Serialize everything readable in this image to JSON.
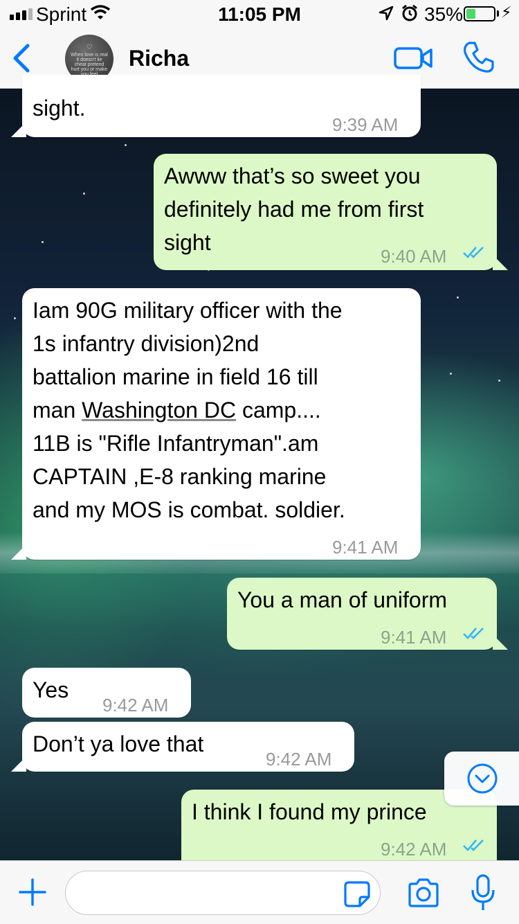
{
  "status_bar": {
    "carrier": "Sprint",
    "time": "11:05 PM",
    "battery_percent": "35%",
    "battery_level": 0.35,
    "icons": [
      "signal-bars-icon",
      "wifi-icon",
      "location-arrow-icon",
      "alarm-icon",
      "battery-icon",
      "charging-bolt-icon"
    ]
  },
  "header": {
    "contact_name": "Richa",
    "avatar_text": "When love is real it doesn't lie cheat pretend hurt you or make you feel unwanted",
    "icons": [
      "back-chevron-icon",
      "video-call-icon",
      "phone-call-icon"
    ]
  },
  "messages": [
    {
      "direction": "in",
      "text": "sight.",
      "time": "9:39 AM"
    },
    {
      "direction": "out",
      "lines": [
        "Awww that’s so sweet you",
        "definitely had me from first",
        "sight"
      ],
      "time": "9:40 AM",
      "read": true
    },
    {
      "direction": "in",
      "lines": [
        "Iam 90G military officer with the",
        "1s infantry division)2nd",
        "battalion marine in field 16 till",
        "man ",
        "Washington DC",
        " camp....",
        "11B is \"Rifle Infantryman\".am",
        "CAPTAIN ,E-8 ranking marine",
        "and my MOS is combat. soldier."
      ],
      "time": "9:41 AM"
    },
    {
      "direction": "out",
      "text": "You a man of uniform",
      "time": "9:41 AM",
      "read": true
    },
    {
      "direction": "in",
      "text": "Yes",
      "time": "9:42 AM"
    },
    {
      "direction": "in",
      "text": "Don’t ya love that",
      "time": "9:42 AM"
    },
    {
      "direction": "out",
      "text": "I think I found my prince",
      "time": "9:42 AM",
      "read": true
    }
  ],
  "composer": {
    "placeholder": "",
    "icons": [
      "plus-icon",
      "sticker-icon",
      "camera-icon",
      "microphone-icon",
      "scroll-down-chevron-icon"
    ]
  },
  "colors": {
    "accent": "#007aff",
    "incoming_bubble": "#ffffff",
    "outgoing_bubble": "#dcf8c6",
    "read_ticks": "#34b7f1",
    "battery_fill": "#4cd964"
  }
}
